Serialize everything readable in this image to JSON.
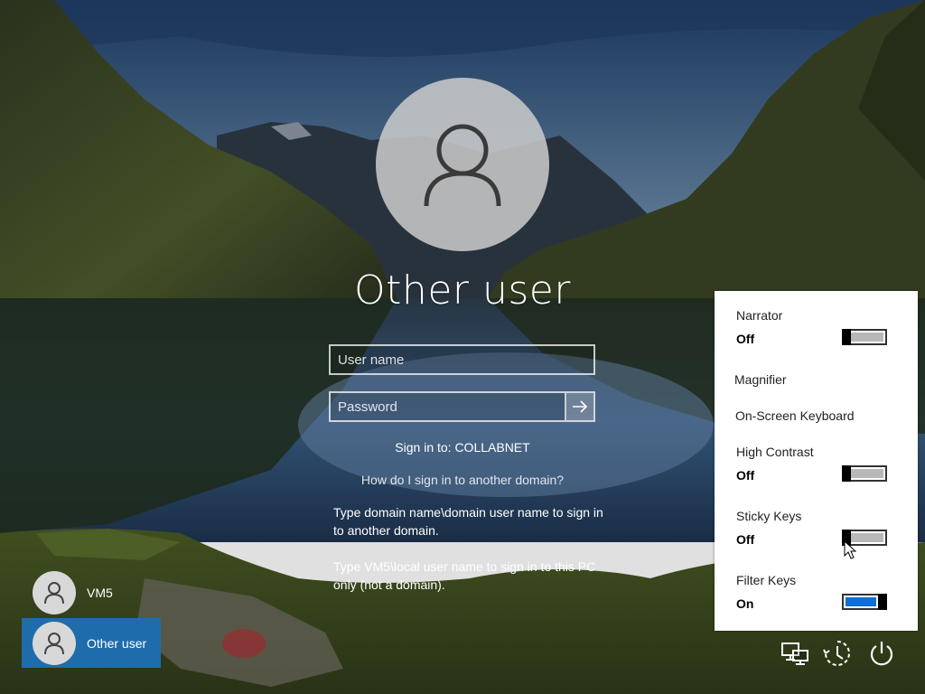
{
  "login": {
    "username_title": "Other user",
    "username_placeholder": "User name",
    "password_placeholder": "Password",
    "sign_in_to": "Sign in to: COLLABNET",
    "help_link": "How do I sign in to another domain?",
    "hint_domain": "Type domain name\\domain user name to sign in to another domain.",
    "hint_local": "Type VM5\\local user name to sign in to this PC only (not a domain)."
  },
  "users": [
    {
      "name": "VM5",
      "selected": false
    },
    {
      "name": "Other user",
      "selected": true
    }
  ],
  "accessibility": {
    "narrator": {
      "label": "Narrator",
      "state": "Off"
    },
    "magnifier": {
      "label": "Magnifier"
    },
    "osk": {
      "label": "On-Screen Keyboard"
    },
    "high_contrast": {
      "label": "High Contrast",
      "state": "Off"
    },
    "sticky_keys": {
      "label": "Sticky Keys",
      "state": "Off"
    },
    "filter_keys": {
      "label": "Filter Keys",
      "state": "On"
    }
  },
  "corner_icons": [
    "network-icon",
    "ease-of-access-icon",
    "power-icon"
  ],
  "colors": {
    "selected_user": "#1f6cac",
    "toggle_on": "#0f6fd6"
  }
}
